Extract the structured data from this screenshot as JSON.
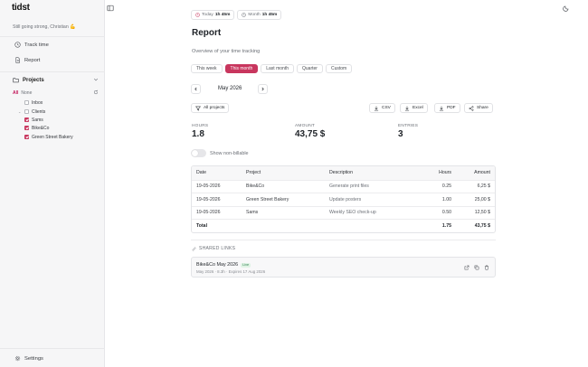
{
  "app": {
    "name": "tidst",
    "greeting": "Still going strong, Christian 💪"
  },
  "sidebar": {
    "nav": [
      {
        "label": "Track time",
        "icon": "clock-icon"
      },
      {
        "label": "Report",
        "icon": "document-icon"
      }
    ],
    "projects_label": "Projects",
    "filter": {
      "all": "All",
      "none": "None"
    },
    "tree": [
      {
        "label": "Inbox",
        "checked": false
      },
      {
        "label": "Clients",
        "checked": false
      },
      {
        "label": "Sams",
        "checked": true
      },
      {
        "label": "Bike&Co",
        "checked": true
      },
      {
        "label": "Green Street Bakery",
        "checked": true
      }
    ],
    "settings_label": "Settings"
  },
  "topbar": {
    "today": {
      "label": "Today",
      "value": "1h 45m"
    },
    "month": {
      "label": "Month",
      "value": "1h 45m"
    }
  },
  "report": {
    "title": "Report",
    "subtitle": "Overview of your time tracking",
    "tabs": [
      "This week",
      "This month",
      "Last month",
      "Quarter",
      "Custom"
    ],
    "active_tab": "This month",
    "period": "May 2026",
    "filter_button": "All projects",
    "exports": [
      "CSV",
      "Excel",
      "PDF",
      "Share"
    ],
    "stats": [
      {
        "label": "HOURS",
        "value": "1.8"
      },
      {
        "label": "AMOUNT",
        "value": "43,75 $"
      },
      {
        "label": "ENTRIES",
        "value": "3"
      }
    ],
    "toggle_label": "Show non-billable",
    "table": {
      "columns": [
        "Date",
        "Project",
        "Description",
        "Hours",
        "Amount"
      ],
      "rows": [
        [
          "19-05-2026",
          "Bike&Co",
          "Generate print files",
          "0.25",
          "6,25 $"
        ],
        [
          "19-05-2026",
          "Green Street Bakery",
          "Update posters",
          "1.00",
          "25,00 $"
        ],
        [
          "19-05-2026",
          "Sams",
          "Weekly SEO check-up",
          "0.50",
          "12,50 $"
        ]
      ],
      "total": {
        "label": "Total",
        "hours": "1.75",
        "amount": "43,75 $"
      }
    },
    "shared": {
      "title": "SHARED LINKS",
      "link": {
        "name": "Bike&Co May 2026",
        "badge": "Live",
        "meta": "May 2026 · 8.3h · Expires 17 Aug 2026"
      }
    }
  },
  "colors": {
    "accent": "#c8365e",
    "sidebar_bg": "#f6f6f7"
  }
}
